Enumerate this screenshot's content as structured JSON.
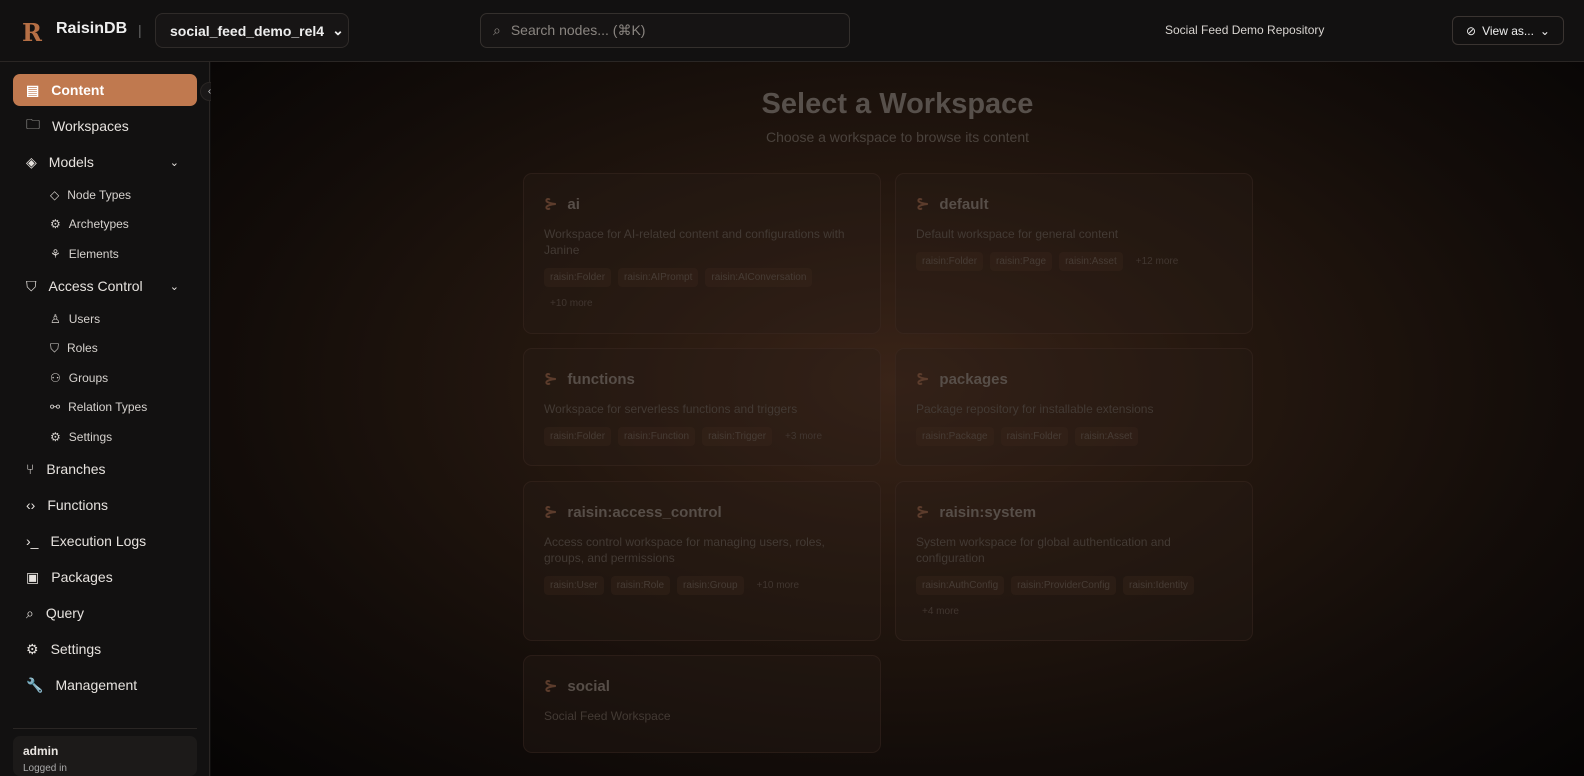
{
  "header": {
    "brand": "RaisinDB",
    "separator": "|",
    "repo_selector": "social_feed_demo_rel4",
    "search_placeholder": "Search nodes... (⌘K)",
    "repository_name": "Social Feed Demo Repository",
    "view_as": "View as..."
  },
  "sidebar": {
    "items": [
      {
        "label": "Content",
        "active": true
      },
      {
        "label": "Workspaces"
      },
      {
        "label": "Models",
        "expandable": true
      },
      {
        "label": "Node Types",
        "sub": true
      },
      {
        "label": "Archetypes",
        "sub": true
      },
      {
        "label": "Elements",
        "sub": true
      },
      {
        "label": "Access Control",
        "expandable": true
      },
      {
        "label": "Users",
        "sub": true
      },
      {
        "label": "Roles",
        "sub": true
      },
      {
        "label": "Groups",
        "sub": true
      },
      {
        "label": "Relation Types",
        "sub": true
      },
      {
        "label": "Settings",
        "sub": true
      },
      {
        "label": "Branches"
      },
      {
        "label": "Functions"
      },
      {
        "label": "Execution Logs"
      },
      {
        "label": "Packages"
      },
      {
        "label": "Query"
      },
      {
        "label": "Settings"
      },
      {
        "label": "Management"
      }
    ],
    "user": {
      "name": "admin",
      "status": "Logged in"
    }
  },
  "main": {
    "title": "Select a Workspace",
    "subtitle": "Choose a workspace to browse its content",
    "workspaces": [
      {
        "name": "ai",
        "description": "Workspace for AI-related content and configurations with Janine",
        "tags": [
          "raisin:Folder",
          "raisin:AIPrompt",
          "raisin:AIConversation"
        ],
        "more": "+10 more"
      },
      {
        "name": "default",
        "description": "Default workspace for general content",
        "tags": [
          "raisin:Folder",
          "raisin:Page",
          "raisin:Asset"
        ],
        "more": "+12 more"
      },
      {
        "name": "functions",
        "description": "Workspace for serverless functions and triggers",
        "tags": [
          "raisin:Folder",
          "raisin:Function",
          "raisin:Trigger"
        ],
        "more": "+3 more"
      },
      {
        "name": "packages",
        "description": "Package repository for installable extensions",
        "tags": [
          "raisin:Package",
          "raisin:Folder",
          "raisin:Asset"
        ],
        "more": ""
      },
      {
        "name": "raisin:access_control",
        "description": "Access control workspace for managing users, roles, groups, and permissions",
        "tags": [
          "raisin:User",
          "raisin:Role",
          "raisin:Group"
        ],
        "more": "+10 more"
      },
      {
        "name": "raisin:system",
        "description": "System workspace for global authentication and configuration",
        "tags": [
          "raisin:AuthConfig",
          "raisin:ProviderConfig",
          "raisin:Identity"
        ],
        "more": "+4 more"
      },
      {
        "name": "social",
        "description": "Social Feed Workspace",
        "tags": [],
        "more": ""
      }
    ]
  }
}
